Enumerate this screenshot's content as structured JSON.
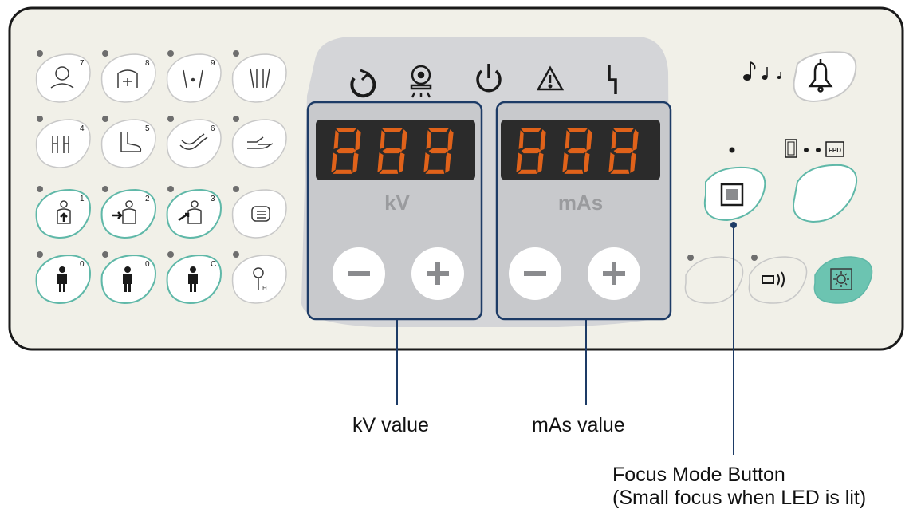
{
  "panel": {
    "display_left": {
      "digits": "888",
      "unit": "kV",
      "minus_label": "−",
      "plus_label": "+"
    },
    "display_right": {
      "digits": "888",
      "unit": "mAs",
      "minus_label": "−",
      "plus_label": "+"
    },
    "preset_numbers": [
      "7",
      "8",
      "9",
      "4",
      "5",
      "6",
      "1",
      "2",
      "3",
      "0",
      "0",
      "C"
    ],
    "key_label": "H",
    "fpd_label": "FPD",
    "colors": {
      "panel_bg": "#f1f0e8",
      "panel_border": "#1a1a1a",
      "display_bg": "#2b2b2b",
      "segment_on": "#e0621a",
      "segment_dim": "#5a2a15",
      "teal": "#5fb8a8",
      "teal_fill": "#6cc4b1",
      "gray_zone": "#d4d5d8",
      "highlight_frame": "#1d3b66"
    },
    "icons": [
      "head-icon",
      "chest-icon",
      "pelvis-icon",
      "legs-icon",
      "hands-icon",
      "foot-icon",
      "arm-icon",
      "hand-icon",
      "patient-supine-icon",
      "patient-side-icon",
      "patient-oblique-icon",
      "list-icon",
      "person-icon",
      "key-icon",
      "ready-icon",
      "radiation-icon",
      "power-icon",
      "warning-icon",
      "exposure-icon",
      "music-notes-icon",
      "bell-icon",
      "focus-square-icon",
      "cassette-icon",
      "speaker-icon",
      "light-field-icon"
    ]
  },
  "callouts": {
    "kv": "kV value",
    "mas": "mAs value",
    "focus_line1": "Focus Mode Button",
    "focus_line2": "(Small focus when LED is lit)"
  }
}
